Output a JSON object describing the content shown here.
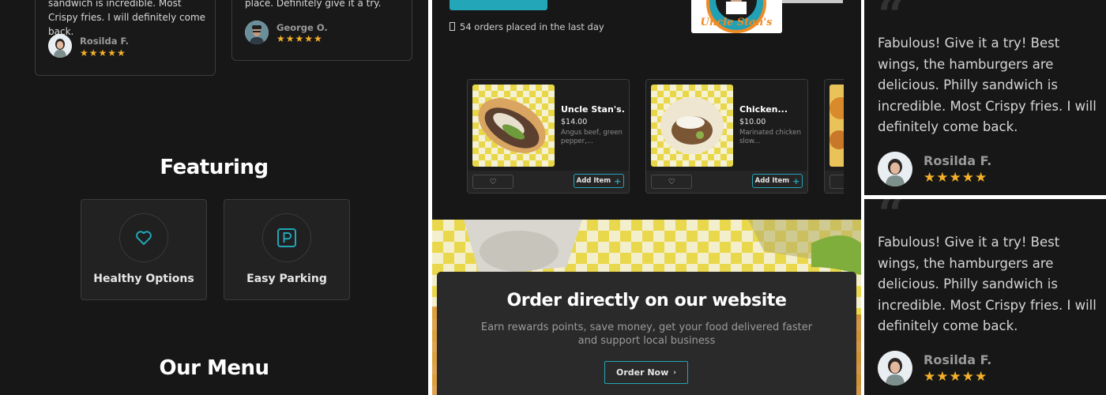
{
  "reviews_left": [
    {
      "text": "sandwich is incredible. Most Crispy fries. I will definitely come back.",
      "name": "Rosilda F.",
      "stars": "★★★★★"
    },
    {
      "text": "place. Definitely give it a try.",
      "name": "George O.",
      "stars": "★★★★★"
    }
  ],
  "featuring": {
    "title": "Featuring",
    "items": [
      {
        "label": "Healthy Options",
        "icon": "heart-icon"
      },
      {
        "label": "Easy Parking",
        "icon": "parking-icon"
      }
    ]
  },
  "menu_title": "Our Menu",
  "orders_info": {
    "icon": "box-icon",
    "text": "54 orders placed in the last day"
  },
  "logo_text": "Uncle Stan's",
  "menu_items": [
    {
      "name": "Uncle Stan's...",
      "price": "$14.00",
      "desc": "Angus beef, green pepper,...",
      "add_label": "Add Item"
    },
    {
      "name": "Chicken...",
      "price": "$10.00",
      "desc": "Marinated chicken slow...",
      "add_label": "Add Item"
    }
  ],
  "order_banner": {
    "title": "Order directly on our website",
    "subtitle": "Earn rewards points, save money, get your food delivered faster and support local business",
    "button": "Order Now"
  },
  "testimonials": [
    {
      "quote_mark": "“",
      "text": "Fabulous! Give it a try! Best wings, the hamburgers are delicious. Philly sandwich is incredible. Most Crispy fries. I will definitely come back.",
      "name": "Rosilda F.",
      "stars": "★★★★★"
    },
    {
      "quote_mark": "“",
      "text": "Fabulous! Give it a try! Best wings, the hamburgers are delicious. Philly sandwich is incredible. Most Crispy fries. I will definitely come back.",
      "name": "Rosilda F.",
      "stars": "★★★★★"
    }
  ],
  "colors": {
    "accent": "#22a6b8",
    "star": "#f4b02a",
    "background": "#171717"
  }
}
